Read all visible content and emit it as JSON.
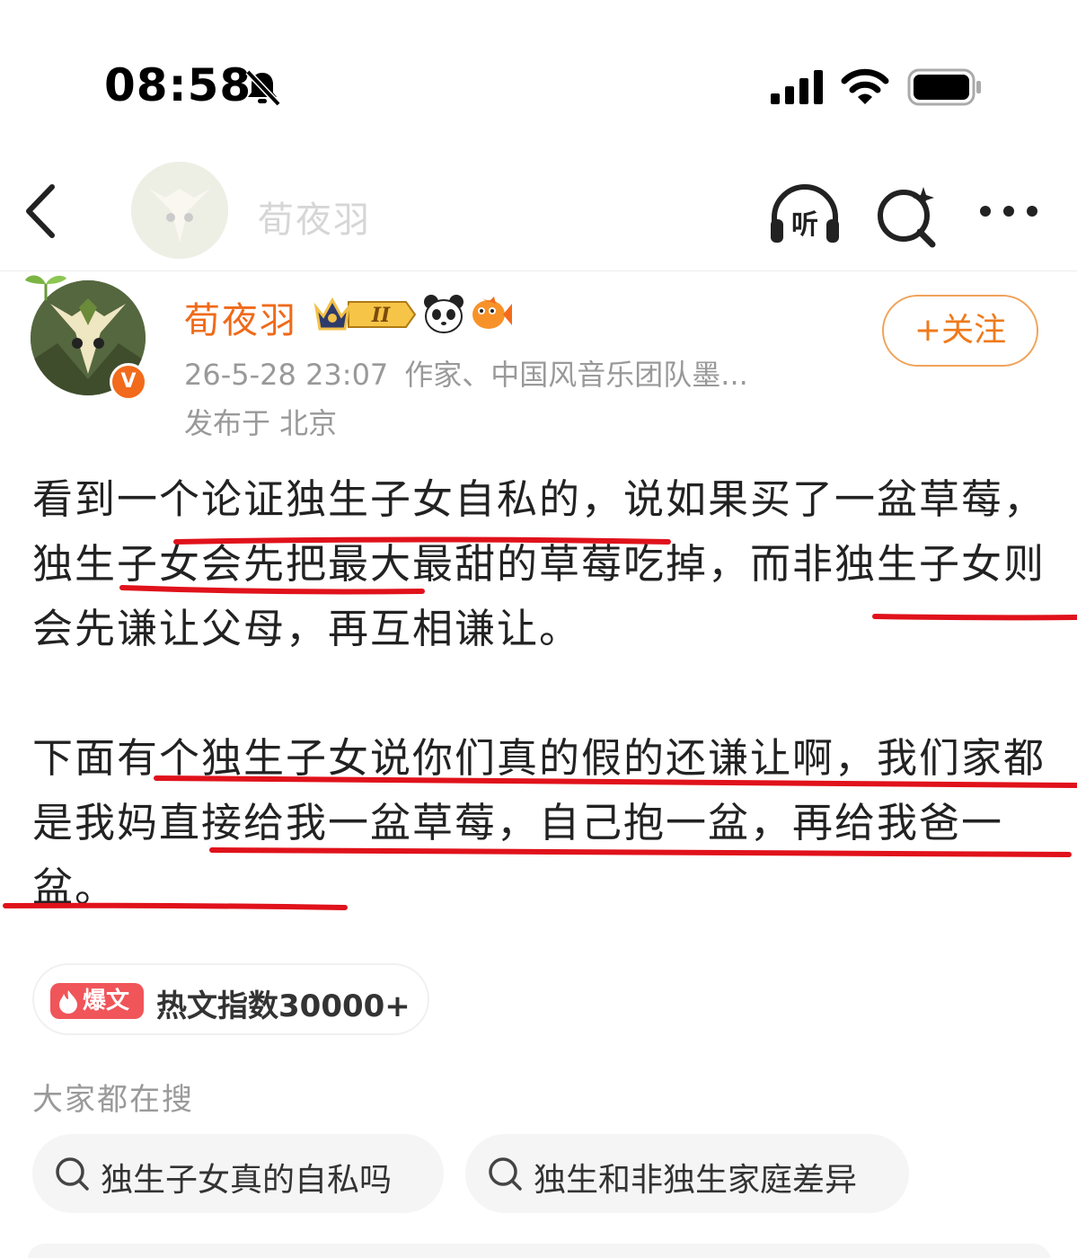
{
  "status_bar": {
    "time": "08:58"
  },
  "nav": {
    "title": "荀夜羽"
  },
  "author": {
    "name": "荀夜羽",
    "level": "II",
    "verified": "V",
    "date": "26-5-28 23:07",
    "description": "作家、中国风音乐团队墨...",
    "location": "发布于 北京",
    "follow_label": "+关注"
  },
  "post": {
    "paragraph_1": "看到一个论证独生子女自私的，说如果买了一盆草莓，独生子女会先把最大最甜的草莓吃掉，而非独生子女则会先谦让父母，再互相谦让。",
    "paragraph_2": "下面有个独生子女说你们真的假的还谦让啊，我们家都是我妈直接给我一盆草莓，自己抱一盆，再给我爸一盆。"
  },
  "hot": {
    "badge": "爆文",
    "text": "热文指数30000+"
  },
  "search": {
    "heading": "大家都在搜",
    "chips": [
      {
        "label": "独生子女真的自私吗"
      },
      {
        "label": "独生和非独生家庭差异"
      }
    ]
  },
  "colors": {
    "accent": "#ef6a19",
    "underline": "#e0121b",
    "hot": "#f0555a"
  }
}
